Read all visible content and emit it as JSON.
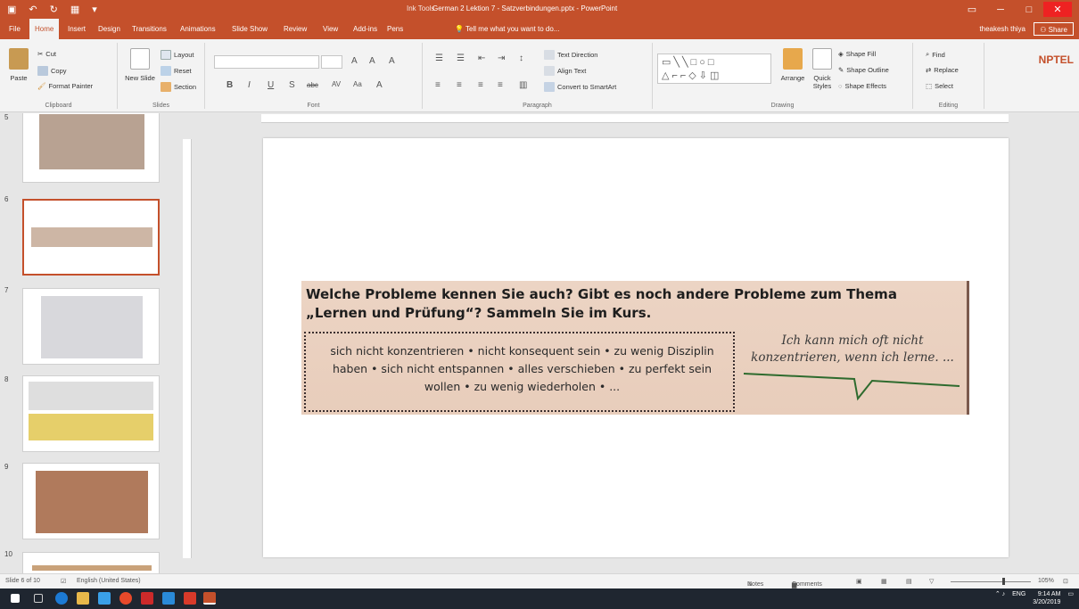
{
  "window": {
    "contextual_tab": "Ink Tools",
    "title": "German 2 Lektion 7 - Satzverbindungen.pptx - PowerPoint"
  },
  "tabs": [
    "File",
    "Home",
    "Insert",
    "Design",
    "Transitions",
    "Animations",
    "Slide Show",
    "Review",
    "View",
    "Add-ins",
    "Pens"
  ],
  "active_tab": "Home",
  "tell_me": "Tell me what you want to do...",
  "user_name": "theakesh thiya",
  "share_label": "Share",
  "ribbon": {
    "clipboard": {
      "paste": "Paste",
      "cut": "Cut",
      "copy": "Copy",
      "format_painter": "Format Painter",
      "label": "Clipboard"
    },
    "slides": {
      "new_slide": "New Slide",
      "layout": "Layout",
      "reset": "Reset",
      "section": "Section",
      "label": "Slides"
    },
    "font": {
      "label": "Font"
    },
    "paragraph": {
      "text_direction": "Text Direction",
      "align_text": "Align Text",
      "convert_smartart": "Convert to SmartArt",
      "label": "Paragraph"
    },
    "drawing": {
      "arrange": "Arrange",
      "quick_styles": "Quick Styles",
      "shape_fill": "Shape Fill",
      "shape_outline": "Shape Outline",
      "shape_effects": "Shape Effects",
      "label": "Drawing"
    },
    "editing": {
      "find": "Find",
      "replace": "Replace",
      "select": "Select",
      "label": "Editing"
    }
  },
  "logo": "NPTEL",
  "thumbnails": [
    {
      "num": "5"
    },
    {
      "num": "6"
    },
    {
      "num": "7"
    },
    {
      "num": "8"
    },
    {
      "num": "9"
    },
    {
      "num": "10"
    }
  ],
  "slide": {
    "question": "Welche Probleme kennen Sie auch? Gibt es noch andere Probleme zum Thema „Lernen und Prüfung“? Sammeln Sie im Kurs.",
    "words": "sich nicht konzentrieren • nicht konsequent sein • zu wenig Disziplin haben • sich nicht entspannen • alles verschieben • zu perfekt sein wollen • zu wenig wiederholen • ...",
    "bubble": "Ich kann mich oft nicht konzentrieren, wenn ich lerne. ..."
  },
  "status": {
    "slide_of": "Slide 6 of 10",
    "language": "English (United States)",
    "notes": "Notes",
    "comments": "Comments",
    "zoom": "105%"
  },
  "taskbar": {
    "lang": "ENG",
    "time": "9:14 AM",
    "date": "3/20/2019"
  }
}
